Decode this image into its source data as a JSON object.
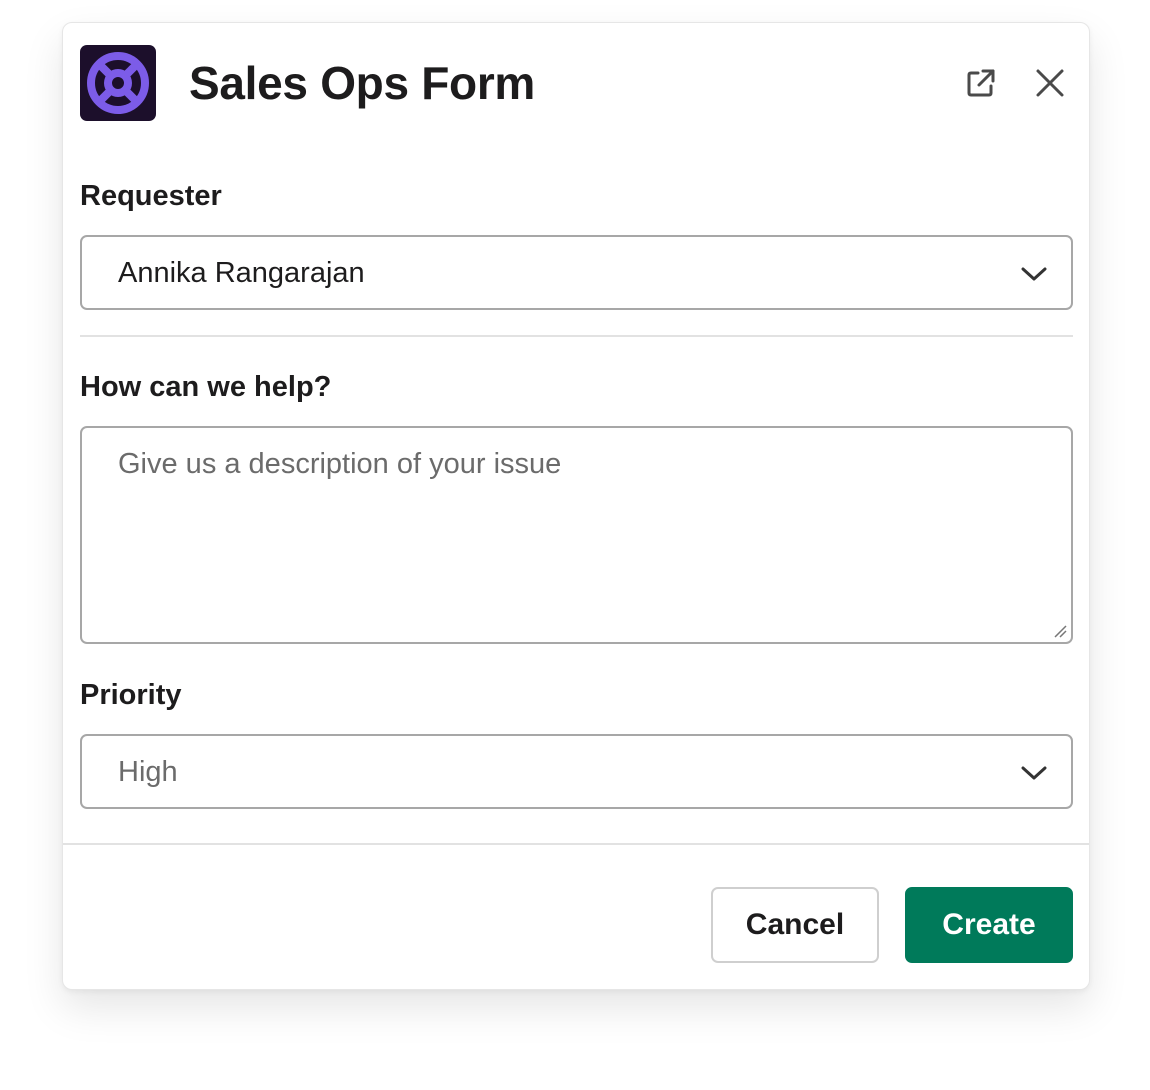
{
  "header": {
    "title": "Sales Ops Form",
    "logo_icon": "lifebuoy-icon",
    "logo_color": "#7c5ce8",
    "logo_bg": "#1c0f2b",
    "open_icon": "external-link-icon",
    "close_icon": "close-icon"
  },
  "requester": {
    "label": "Requester",
    "value": "Annika Rangarajan"
  },
  "help": {
    "label": "How can we help?",
    "placeholder": "Give us a description of your issue"
  },
  "priority": {
    "label": "Priority",
    "value": "High"
  },
  "footer": {
    "cancel_label": "Cancel",
    "create_label": "Create",
    "create_color": "#007a5a"
  }
}
